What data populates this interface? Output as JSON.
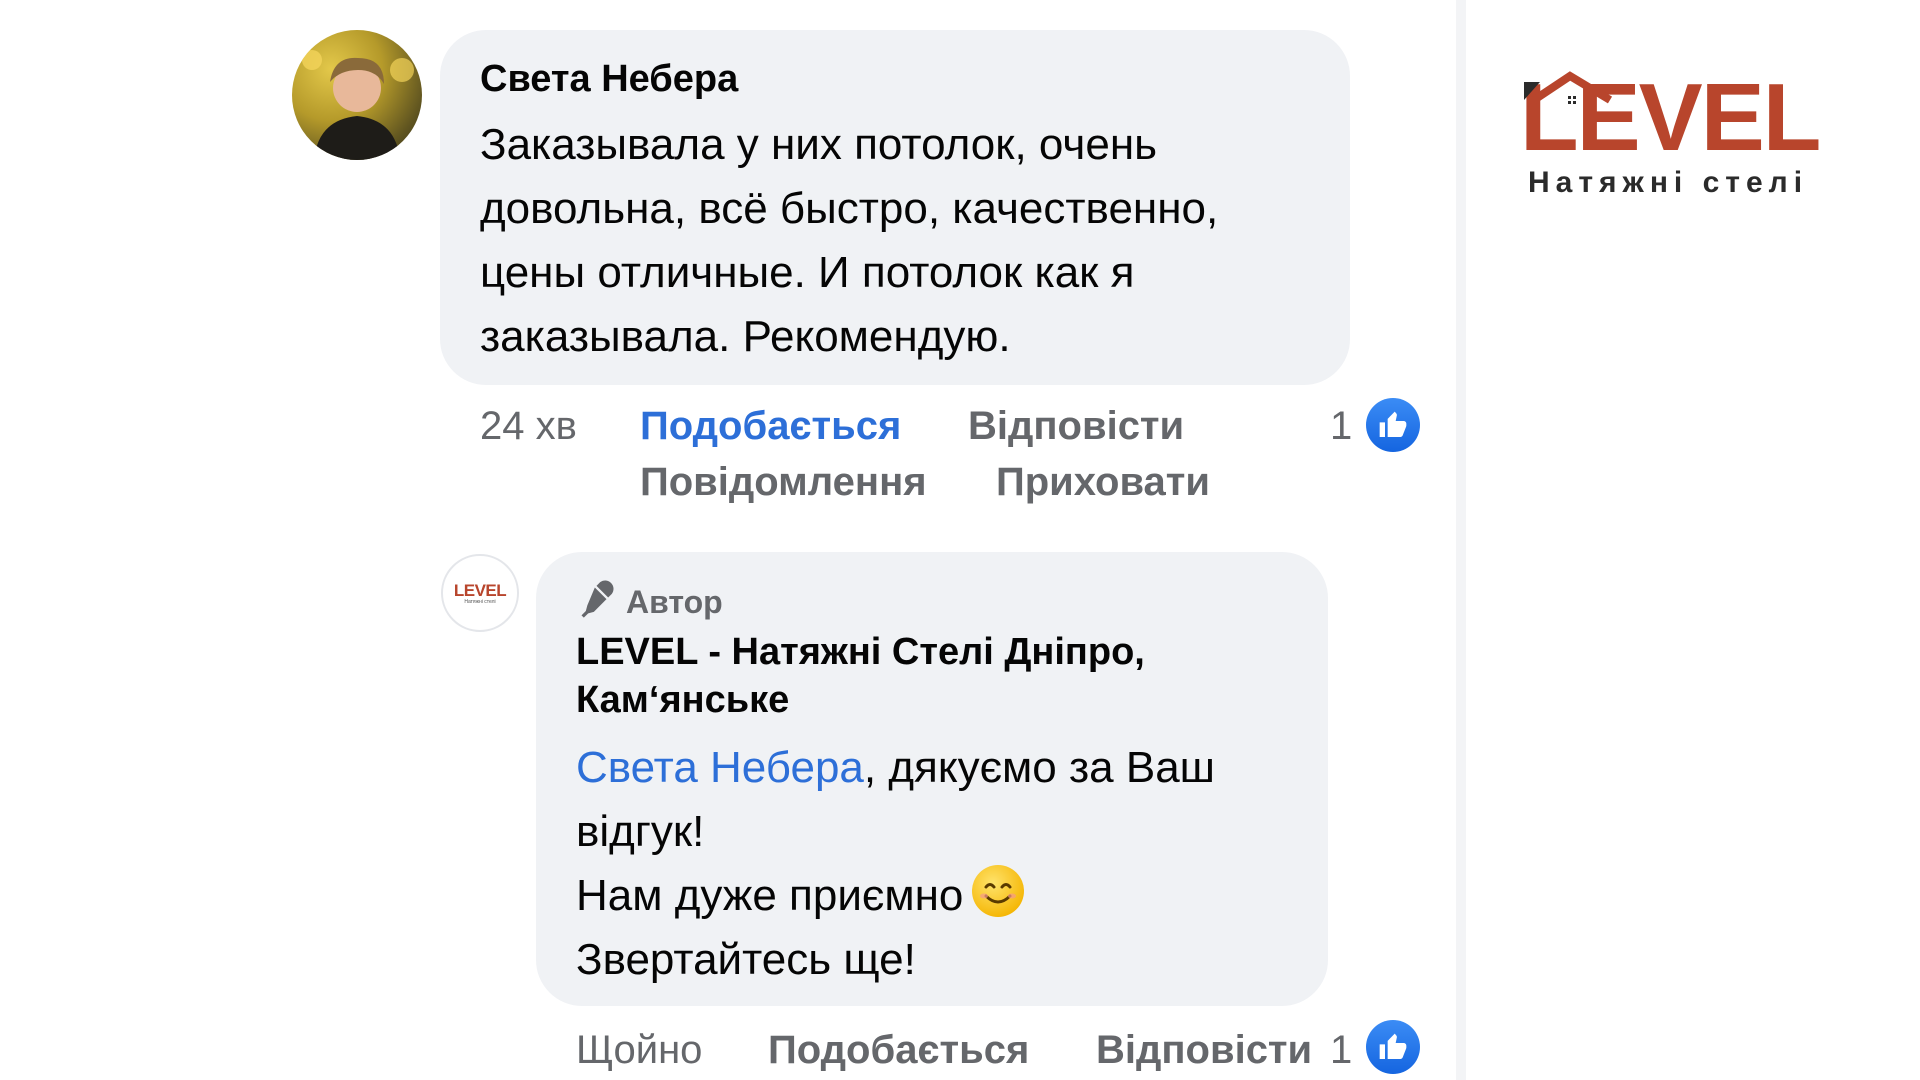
{
  "comment": {
    "author": "Света Небера",
    "text": "Заказывала у них потолок, очень довольна, всё быстро, качественно, цены отличные. И потолок как я заказывала. Рекомендую.",
    "time": "24 хв",
    "like_label": "Подобається",
    "reply_label": "Відповісти",
    "message_label": "Повідомлення",
    "hide_label": "Приховати",
    "reaction_count": "1"
  },
  "reply": {
    "author_badge": "Автор",
    "author": "LEVEL - Натяжні Стелі Дніпро, Кам‘янське",
    "mention": "Света Небера",
    "text_after_mention": ", дякуємо за Ваш відгук!",
    "line2": "Нам дуже приємно",
    "line3": "Звертайтесь ще!",
    "time": "Щойно",
    "like_label": "Подобається",
    "reply_label": "Відповісти",
    "reaction_count": "1"
  },
  "brand": {
    "logo_word": "LEVEL",
    "logo_subtitle": "Натяжні стелі",
    "avatar_logo_word": "LEVEL",
    "avatar_logo_subtitle": "Натяжні стелі",
    "accent_color": "#b8452c",
    "link_color": "#2d6fd8"
  },
  "icons": {
    "like": "thumbs-up-icon",
    "author_badge": "microphone-icon",
    "emoji": "smiling-face-icon"
  }
}
